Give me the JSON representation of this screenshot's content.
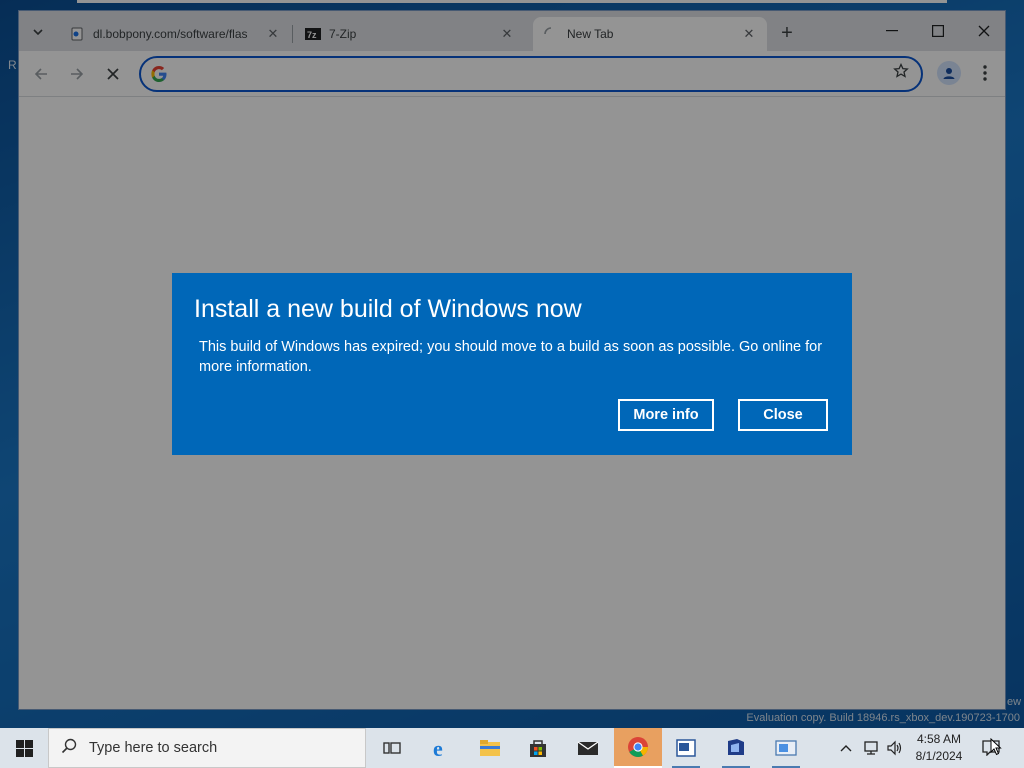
{
  "browser": {
    "tabs": [
      {
        "title": "dl.bobpony.com/software/flas",
        "favicon": "page-icon",
        "active": false
      },
      {
        "title": "7-Zip",
        "favicon": "7zip-icon",
        "active": false
      },
      {
        "title": "New Tab",
        "favicon": "loading-icon",
        "active": true
      }
    ],
    "tab_close_glyph": "✕",
    "new_tab_glyph": "+",
    "window_controls": {
      "minimize": "—",
      "maximize": "☐",
      "close": "✕"
    },
    "omnibox": {
      "value": "",
      "placeholder": ""
    },
    "accent_color": "#0b57d0"
  },
  "dialog": {
    "title": "Install a new build of Windows now",
    "message": "This build of Windows has expired; you should move to a build as soon as possible. Go online for more information.",
    "more_info_label": "More info",
    "close_label": "Close",
    "background_color": "#0067b8"
  },
  "desktop": {
    "watermark": "Evaluation copy. Build 18946.rs_xbox_dev.190723-1700",
    "watermark_tail": "ew",
    "glyph_r": "R"
  },
  "taskbar": {
    "search_placeholder": "Type here to search",
    "apps": [
      "task-view-icon",
      "edge-icon",
      "file-explorer-icon",
      "store-icon",
      "mail-icon",
      "chrome-icon",
      "app-icon",
      "app-icon-2",
      "app-icon-3"
    ],
    "time": "4:58 AM",
    "date": "8/1/2024"
  }
}
